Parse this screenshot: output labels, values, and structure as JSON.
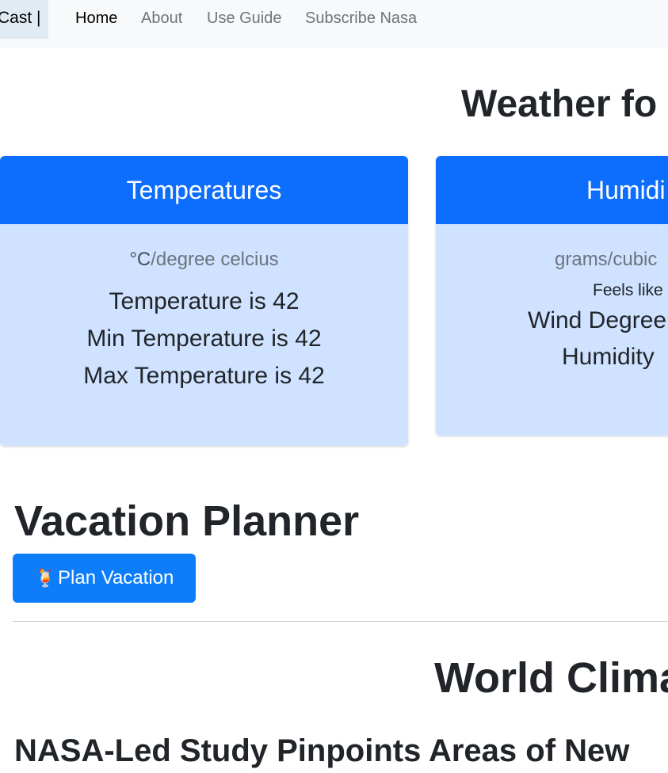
{
  "nav": {
    "brand": "Cast |",
    "links": [
      "Home",
      "About",
      "Use Guide",
      "Subscribe Nasa"
    ]
  },
  "page_title": "Weather fo",
  "cards": {
    "temperature": {
      "header": "Temperatures",
      "unit_symbol": "°C",
      "unit_text": "/degree celcius",
      "lines": [
        "Temperature is 42",
        "Min Temperature is 42",
        "Max Temperature is 42"
      ]
    },
    "humidity": {
      "header": "Humidi",
      "unit": "grams/cubic",
      "feels_like": "Feels like",
      "lines": [
        "Wind Degree",
        "Humidity"
      ]
    }
  },
  "vacation": {
    "title": "Vacation Planner",
    "button_icon": "🍹",
    "button_label": "Plan Vacation"
  },
  "climate_title": "World Clima",
  "news_title": "NASA-Led Study Pinpoints Areas of New",
  "colors": {
    "primary": "#0d6efd",
    "card_bg": "#cfe2ff",
    "navbar_bg": "#f8f9fa"
  }
}
